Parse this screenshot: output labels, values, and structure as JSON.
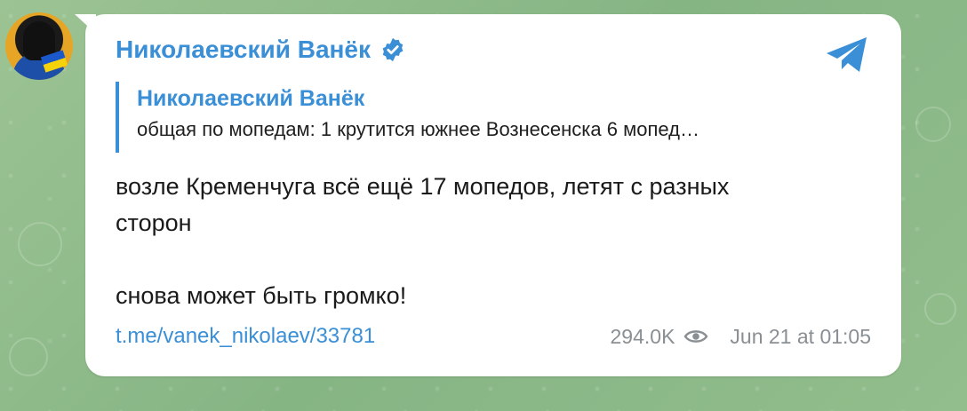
{
  "post": {
    "author": "Николаевский Ванёк",
    "reply": {
      "author": "Николаевский Ванёк",
      "snippet": "общая по мопедам: 1 крутится южнее Вознесенска 6 мопед…"
    },
    "message_lines": [
      "возле Кременчуга всё ещё 17 мопедов, летят с разных",
      "сторон",
      "снова может быть громко!"
    ],
    "link": "t.me/vanek_nikolaev/33781",
    "views": "294.0K",
    "timestamp": "Jun 21 at 01:05"
  },
  "colors": {
    "accent": "#3a8fd6",
    "background": "#8fb98a",
    "bubble": "#ffffff",
    "meta_text": "#8a8f94"
  },
  "icons": {
    "verified": "verified-badge-icon",
    "share": "telegram-plane-icon",
    "views": "eye-icon"
  }
}
